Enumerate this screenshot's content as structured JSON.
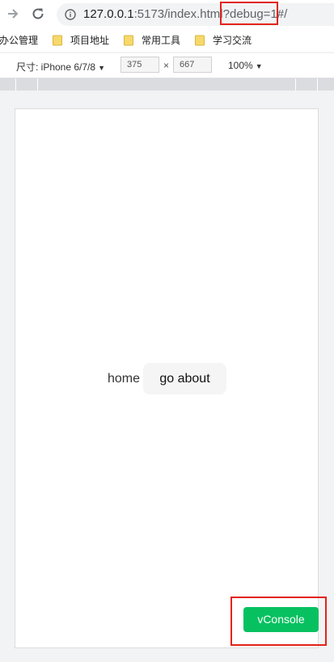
{
  "address_bar": {
    "url_host": "127.0.0.1",
    "url_rest": ":5173/index.html?debug=1#/"
  },
  "bookmarks": [
    {
      "label": "办公管理"
    },
    {
      "label": "项目地址"
    },
    {
      "label": "常用工具"
    },
    {
      "label": "学习交流"
    }
  ],
  "device_toolbar": {
    "size_label": "尺寸: iPhone 6/7/8",
    "width": "375",
    "height": "667",
    "separator": "×",
    "zoom": "100%"
  },
  "page": {
    "home_text": "home",
    "about_button": "go about"
  },
  "vconsole": {
    "label": "vConsole",
    "color": "#07c160"
  },
  "annotations": {
    "highlight_color": "#e2231a"
  },
  "icons": {
    "forward": "arrow-forward-icon",
    "reload": "reload-icon",
    "info": "info-icon",
    "folder": "folder-icon"
  }
}
